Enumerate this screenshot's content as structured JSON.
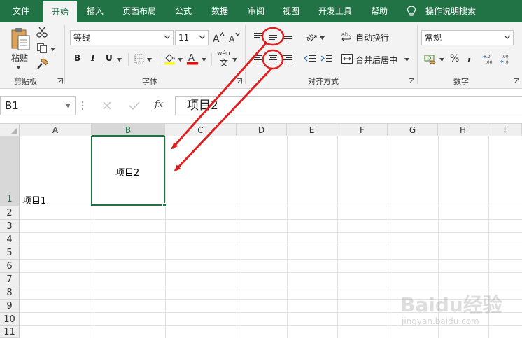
{
  "tabs": [
    {
      "label": "文件"
    },
    {
      "label": "开始"
    },
    {
      "label": "插入"
    },
    {
      "label": "页面布局"
    },
    {
      "label": "公式"
    },
    {
      "label": "数据"
    },
    {
      "label": "审阅"
    },
    {
      "label": "视图"
    },
    {
      "label": "开发工具"
    },
    {
      "label": "帮助"
    }
  ],
  "tell_me": "操作说明搜索",
  "clipboard": {
    "paste_label": "粘贴",
    "group": "剪贴板"
  },
  "font": {
    "name": "等线",
    "size": "11",
    "bold": "B",
    "italic": "I",
    "underline": "U",
    "group": "字体",
    "phonetic_top": "wén",
    "phonetic_bottom": "文"
  },
  "alignment": {
    "wrap_text": "自动换行",
    "merge_center": "合并后居中",
    "group": "对齐方式"
  },
  "number": {
    "format": "常规",
    "percent": "%",
    "comma": ",",
    "group": "数字"
  },
  "formula_bar": {
    "name_box": "B1",
    "fx": "fx",
    "content": "项目2"
  },
  "columns": [
    "A",
    "B",
    "C",
    "D",
    "E",
    "F",
    "G",
    "H",
    "I"
  ],
  "rows": [
    "1",
    "2",
    "3",
    "4",
    "5",
    "6",
    "7",
    "8",
    "9",
    "10",
    "11"
  ],
  "cells": {
    "A1": "项目1",
    "B1": "项目2"
  },
  "colors": {
    "ribbon_green": "#217346",
    "annotation_red": "#e02020"
  },
  "watermark": {
    "brand": "Baidu经验",
    "url": "jingyan.baidu.com"
  }
}
